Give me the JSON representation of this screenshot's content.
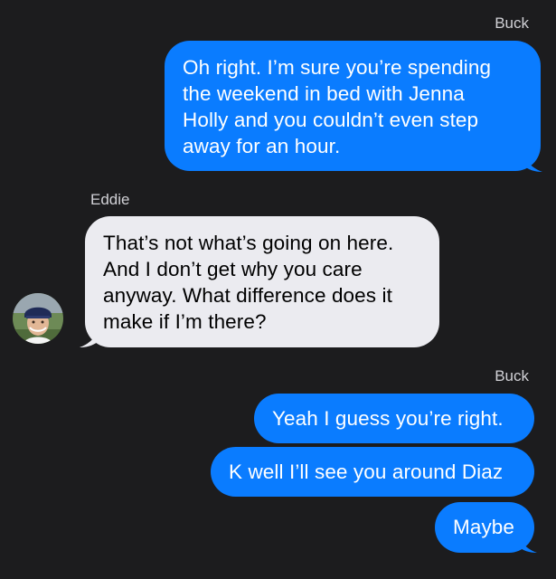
{
  "conversation": {
    "messages": [
      {
        "sender": "Buck",
        "direction": "outgoing",
        "lines": [
          "Oh right. I’m sure you’re spending",
          "the weekend in bed with Jenna",
          "Holly and you couldn’t even step",
          "away for an hour."
        ]
      },
      {
        "sender": "Eddie",
        "direction": "incoming",
        "lines": [
          "That’s not what’s going on here.",
          "And I don’t get why you care",
          "anyway. What difference does it",
          "make if I’m there?"
        ]
      },
      {
        "sender": "Buck",
        "direction": "outgoing",
        "lines": [
          "Yeah I guess you’re right."
        ]
      },
      {
        "sender": "",
        "direction": "outgoing",
        "lines": [
          "K well I’ll see you around Diaz"
        ]
      },
      {
        "sender": "",
        "direction": "outgoing",
        "lines": [
          "Maybe"
        ]
      }
    ]
  },
  "colors": {
    "background": "#1c1c1e",
    "outgoing_bubble": "#0a7cff",
    "incoming_bubble": "#ebebf0",
    "sender_name": "#d1d1d6"
  },
  "icons": {
    "contact_avatar": "avatar-photo-icon"
  }
}
